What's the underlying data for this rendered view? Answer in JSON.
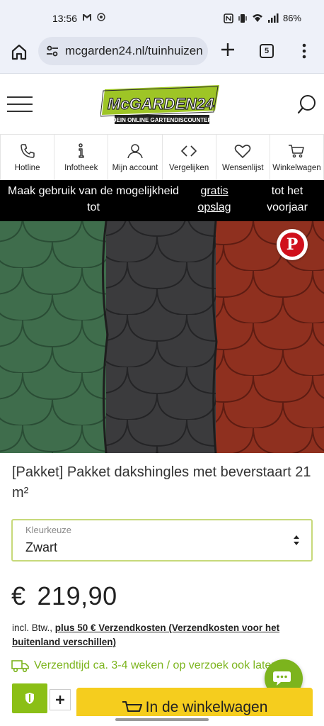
{
  "status_bar": {
    "time": "13:56",
    "battery": "86%",
    "left_icons": [
      "gmail-icon",
      "nfc-assistant-icon"
    ],
    "right_icons": [
      "nfc-icon",
      "vibrate-icon",
      "wifi-icon",
      "signal-icon"
    ]
  },
  "browser": {
    "url": "mcgarden24.nl/tuinhuizen",
    "tab_count": "5"
  },
  "header": {
    "logo_text": "McGARDEN24",
    "logo_tagline": "DEIN ONLINE GARTENDISCOUNTER"
  },
  "nav": {
    "items": [
      {
        "label": "Hotline",
        "icon": "phone-icon"
      },
      {
        "label": "Infotheek",
        "icon": "info-icon"
      },
      {
        "label": "Mijn account",
        "icon": "user-icon"
      },
      {
        "label": "Vergelijken",
        "icon": "compare-icon"
      },
      {
        "label": "Wensenlijst",
        "icon": "heart-icon"
      },
      {
        "label": "Winkelwagen",
        "icon": "cart-icon"
      }
    ]
  },
  "promo": {
    "part1": "Maak gebruik van de mogelijkheid tot",
    "link": "gratis opslag",
    "part2": "tot het voorjaar"
  },
  "product": {
    "title": "[Pakket] Pakket dakshingles met beverstaart 21 m²",
    "select_label": "Kleurkeuze",
    "select_value": "Zwart",
    "currency": "€",
    "price": "219,90",
    "tax_prefix": "incl. Btw., ",
    "tax_link": "plus 50 € Verzendkosten (Verzendkosten voor het buitenland verschillen)",
    "delivery": "Verzendtijd ca. 3-4 weken / op verzoek ook later",
    "add_to_cart": "In de winkelwagen"
  },
  "colors": {
    "accent_green": "#7cb41d",
    "cart_yellow": "#f5cd1e",
    "shingle_green": "#3d6b4a",
    "shingle_black": "#3a3a3c",
    "shingle_red": "#8e2e1e"
  }
}
